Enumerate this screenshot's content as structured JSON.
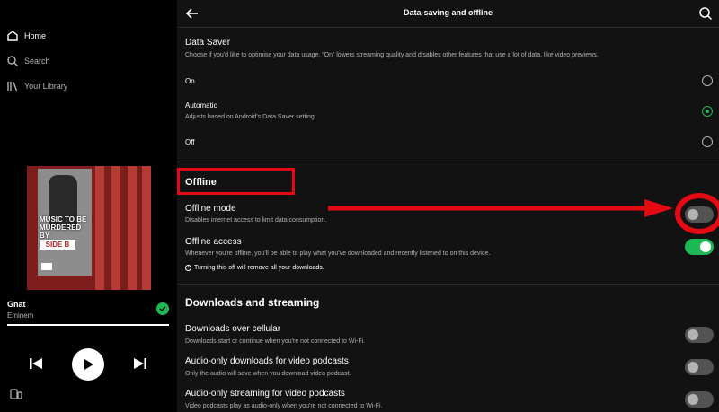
{
  "sidebar": {
    "items": [
      {
        "label": "Home",
        "icon": "home-icon",
        "active": true
      },
      {
        "label": "Search",
        "icon": "search-icon",
        "active": false
      },
      {
        "label": "Your Library",
        "icon": "library-icon",
        "active": false
      }
    ]
  },
  "album_art": {
    "text_line": "MUSIC TO BE MURDERED BY",
    "side": "SIDE B"
  },
  "now_playing": {
    "title": "Gnat",
    "artist": "Eminem",
    "progress_fraction": 1.0,
    "liked": true
  },
  "player_controls": {
    "previous": "skip-previous-icon",
    "play": "play-icon",
    "next": "skip-next-icon",
    "devices": "devices-icon"
  },
  "header": {
    "title": "Data-saving and offline"
  },
  "data_saver": {
    "title": "Data Saver",
    "description": "Choose if you'd like to optimise your data usage. “On” lowers streaming quality and disables other features that use a lot of data, like video previews.",
    "options": [
      {
        "label": "On",
        "description": "",
        "selected": false
      },
      {
        "label": "Automatic",
        "description": "Adjusts based on Android's Data Saver setting.",
        "selected": true
      },
      {
        "label": "Off",
        "description": "",
        "selected": false
      }
    ]
  },
  "offline": {
    "title": "Offline",
    "offline_mode": {
      "title": "Offline mode",
      "description": "Disables internet access to limit data consumption.",
      "enabled": false
    },
    "offline_access": {
      "title": "Offline access",
      "description": "Whenever you're offline, you'll be able to play what you've downloaded and recently listened to on this device.",
      "warning": "Turning this off will remove all your downloads.",
      "enabled": true
    }
  },
  "downloads": {
    "title": "Downloads and streaming",
    "items": [
      {
        "title": "Downloads over cellular",
        "description": "Downloads start or continue when you're not connected to Wi-Fi.",
        "enabled": false
      },
      {
        "title": "Audio-only downloads for video podcasts",
        "description": "Only the audio will save when you download video podcast.",
        "enabled": false
      },
      {
        "title": "Audio-only streaming for video podcasts",
        "description": "Video podcasts play as audio-only when you're not connected to Wi-Fi.",
        "enabled": false
      }
    ]
  },
  "colors": {
    "accent": "#1db954",
    "annotation": "#e50914",
    "background": "#121212",
    "sidebar": "#000000"
  }
}
